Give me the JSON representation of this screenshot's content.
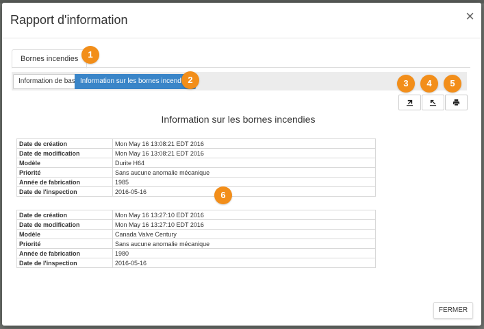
{
  "dialog": {
    "title": "Rapport d'information",
    "close_label": "×"
  },
  "tabs": [
    {
      "label": "Bornes incendies"
    }
  ],
  "toggles": [
    {
      "label": "Information de base",
      "active": false
    },
    {
      "label": "Information sur les bornes incendies",
      "active": true
    }
  ],
  "toolbar": {
    "buttons": [
      {
        "icon": "export-icon"
      },
      {
        "icon": "export-excel-icon"
      },
      {
        "icon": "print-icon"
      }
    ]
  },
  "badges": [
    "1",
    "2",
    "3",
    "4",
    "5",
    "6"
  ],
  "section_title": "Information sur les bornes incendies",
  "records": [
    {
      "rows": [
        {
          "label": "Date de création",
          "value": "Mon May 16 13:08:21 EDT 2016"
        },
        {
          "label": "Date de modification",
          "value": "Mon May 16 13:08:21 EDT 2016"
        },
        {
          "label": "Modèle",
          "value": "Durite H64"
        },
        {
          "label": "Priorité",
          "value": "Sans aucune anomalie mécanique"
        },
        {
          "label": "Année de fabrication",
          "value": "1985"
        },
        {
          "label": "Date de l'inspection",
          "value": "2016-05-16"
        }
      ]
    },
    {
      "rows": [
        {
          "label": "Date de création",
          "value": "Mon May 16 13:27:10 EDT 2016"
        },
        {
          "label": "Date de modification",
          "value": "Mon May 16 13:27:10 EDT 2016"
        },
        {
          "label": "Modèle",
          "value": "Canada Valve Century"
        },
        {
          "label": "Priorité",
          "value": "Sans aucune anomalie mécanique"
        },
        {
          "label": "Année de fabrication",
          "value": "1980"
        },
        {
          "label": "Date de l'inspection",
          "value": "2016-05-16"
        }
      ]
    }
  ],
  "footer": {
    "close_button": "FERMER"
  },
  "colors": {
    "badge": "#f28e1a",
    "active_toggle": "#3a85c8"
  }
}
